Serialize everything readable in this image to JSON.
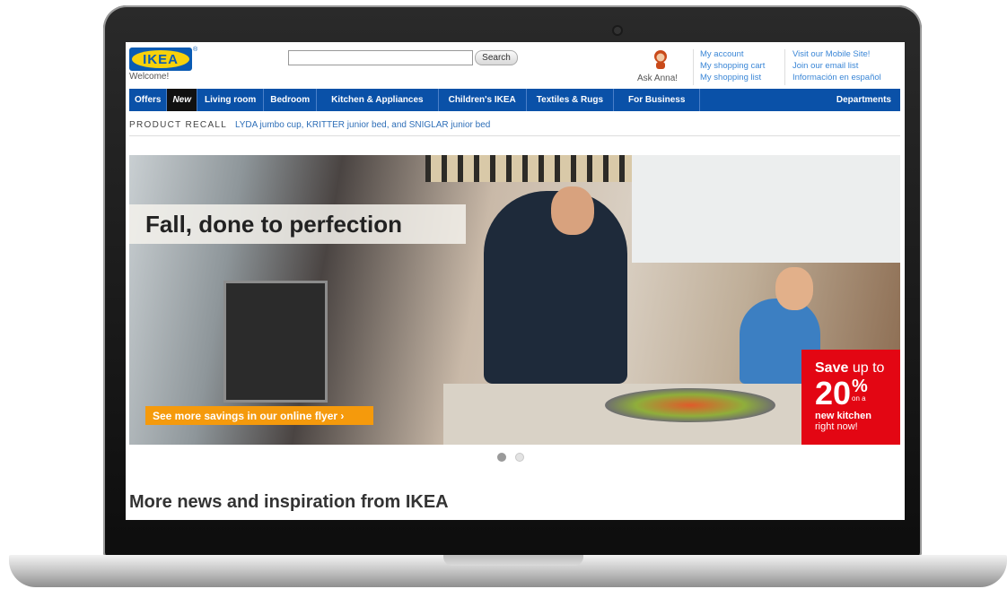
{
  "header": {
    "logo_text": "IKEA",
    "registered_mark": "®",
    "welcome": "Welcome!",
    "search": {
      "value": "",
      "button": "Search"
    },
    "ask_anna": "Ask Anna!",
    "account_links": [
      "My account",
      "My shopping cart",
      "My shopping list"
    ],
    "extra_links": [
      "Visit our Mobile Site!",
      "Join our email list",
      "Información en español"
    ]
  },
  "nav": {
    "items": [
      "Offers",
      "New",
      "Living room",
      "Bedroom",
      "Kitchen & Appliances",
      "Children's IKEA",
      "Textiles & Rugs",
      "For Business"
    ],
    "departments": "Departments"
  },
  "recall": {
    "label": "PRODUCT RECALL",
    "link": "LYDA jumbo cup, KRITTER junior bed, and SNIGLAR junior bed"
  },
  "hero": {
    "headline": "Fall, done to perfection",
    "flyer_cta": "See more savings in our online flyer ›",
    "promo": {
      "save": "Save",
      "up_to": "up to",
      "number": "20",
      "percent": "%",
      "on_a": "on a",
      "new_kitchen": "new kitchen",
      "right_now": "right now!"
    }
  },
  "news_heading": "More news and inspiration from IKEA",
  "colors": {
    "nav_blue": "#0a51a8",
    "logo_yellow": "#f7d10b",
    "promo_red": "#e30613",
    "flyer_orange": "#f59a0c"
  }
}
